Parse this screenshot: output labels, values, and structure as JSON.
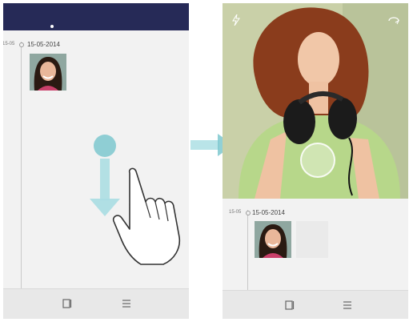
{
  "left_screen": {
    "timeline": {
      "date_short": "15-05",
      "date_full": "15-05-2014"
    },
    "bottom_bar": {
      "icons": [
        "panel-icon",
        "menu-icon"
      ]
    },
    "gesture": {
      "direction": "down",
      "icon": "swipe-hand-icon"
    }
  },
  "right_screen": {
    "camera": {
      "top_left_icon": "flash-icon",
      "top_right_icon": "switch-camera-icon",
      "shutter_icon": "shutter-button"
    },
    "timeline": {
      "date_short": "15-05",
      "date_full": "15-05-2014"
    },
    "bottom_bar": {
      "icons": [
        "panel-icon",
        "menu-icon"
      ]
    }
  },
  "colors": {
    "header": "#262a57",
    "accent": "#7ec8cf",
    "screen_bg": "#f2f2f2"
  }
}
